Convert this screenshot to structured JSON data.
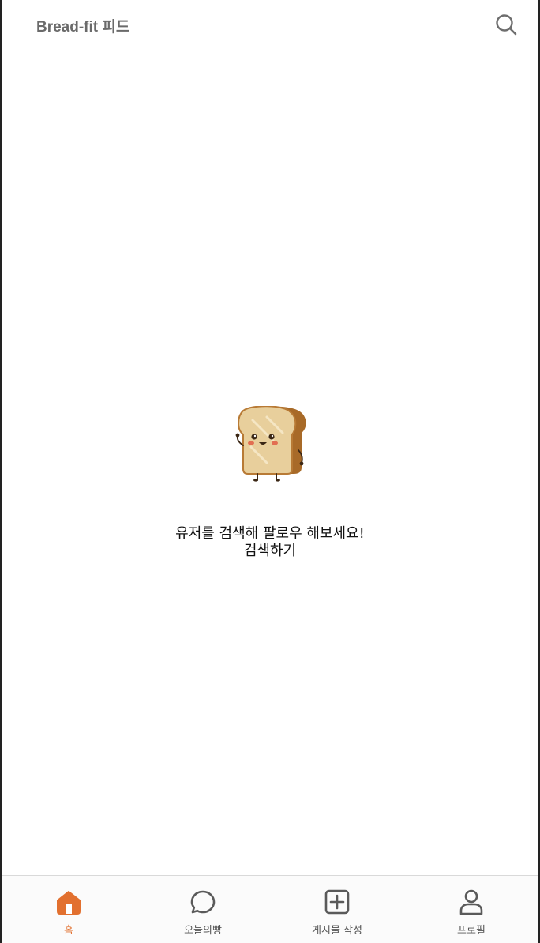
{
  "header": {
    "title": "Bread-fit 피드",
    "search_icon": "search-icon"
  },
  "empty_state": {
    "message": "유저를 검색해 팔로우 해보세요!",
    "link_label": "검색하기",
    "illustration": "bread-mascot"
  },
  "bottom_nav": {
    "items": [
      {
        "label": "홈",
        "icon": "home-icon",
        "active": true
      },
      {
        "label": "오늘의빵",
        "icon": "chat-bubble-icon",
        "active": false
      },
      {
        "label": "게시물 작성",
        "icon": "plus-square-icon",
        "active": false
      },
      {
        "label": "프로필",
        "icon": "user-icon",
        "active": false
      }
    ]
  },
  "colors": {
    "accent": "#e2702f",
    "icon_gray": "#5a5a5a",
    "title_gray": "#6a6a6a"
  }
}
